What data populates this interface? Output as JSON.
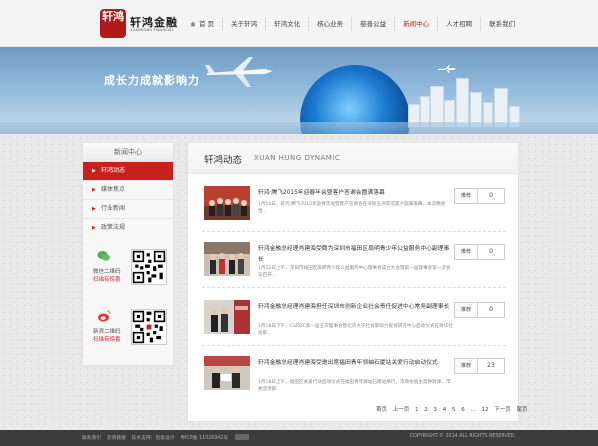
{
  "header": {
    "logo_seal": "轩鸿",
    "logo_name": "轩鸿金融",
    "logo_en": "XUANHONG FINANCIAL",
    "nav": [
      {
        "label": "首 页",
        "active": false
      },
      {
        "label": "关于轩鸿",
        "active": false
      },
      {
        "label": "轩鸿文化",
        "active": false
      },
      {
        "label": "核心业务",
        "active": false
      },
      {
        "label": "慈善公益",
        "active": false
      },
      {
        "label": "新闻中心",
        "active": true
      },
      {
        "label": "人才招聘",
        "active": false
      },
      {
        "label": "联系我们",
        "active": false
      }
    ]
  },
  "banner": {
    "slogan": "成长力成就影响力"
  },
  "sidebar": {
    "title": "新闻中心",
    "items": [
      {
        "label": "轩鸿动态",
        "active": true
      },
      {
        "label": "媒体焦点",
        "active": false
      },
      {
        "label": "行业新闻",
        "active": false
      },
      {
        "label": "政策法规",
        "active": false
      }
    ],
    "qr": [
      {
        "icon": "wechat-icon",
        "line1": "微信二维码",
        "line2": "扫描有惊喜"
      },
      {
        "icon": "weibo-icon",
        "line1": "新浪二维码",
        "line2": "扫描有惊喜"
      }
    ]
  },
  "main": {
    "title_cn": "轩鸿动态",
    "title_en": "XUAN HUNG DYNAMIC",
    "recommend_label": "推荐",
    "articles": [
      {
        "title": "轩鸿·腾飞2015年迎春年会暨客户答谢会圆满落幕",
        "desc": "1月10日，轩鸿·腾飞2015年迎春年会暨客户答谢会在深圳五洲宾馆盛大圆满落幕，本次晚会恰...",
        "count": "0"
      },
      {
        "title": "轩鸿金融总经理肖建海受聘为深圳市福田区扇明青少年公益服务中心副理事长",
        "desc": "1月22日上午，深圳市福田区扇明青少年公益服务中心理事会成立大会暨第一届理事会第一次会议召开...",
        "count": "0"
      },
      {
        "title": "轩鸿金融总经理肖建海担任深圳市创新企业社会责任促进中心常务副理事长",
        "desc": "1月18日下午，CSRDC第一届五次理事会暨北京大学社会影响力投资研究中心启动仪式在清华社会影...",
        "count": "0"
      },
      {
        "title": "轩鸿金融总经理肖建海受邀出席福田青年领袖石厦站关爱行动启动仪式",
        "desc": "1月18日上午，福田区关爱行动启动仪式在福田青年驿站石厦站举行，市政协副主席钟晓锋、市委宣传部...",
        "count": "23"
      }
    ],
    "pager": [
      "首页",
      "上一页",
      "1",
      "2",
      "3",
      "4",
      "5",
      "6",
      "...",
      "12",
      "下一页",
      "尾页"
    ]
  },
  "footer": {
    "links": [
      "联系我们",
      "友情链接",
      "技术支持：创意设计",
      "粤ICP备 11026942号"
    ],
    "copyright": "COPYRIGHT © 2014 ALL RIGHTS RESERVED."
  }
}
